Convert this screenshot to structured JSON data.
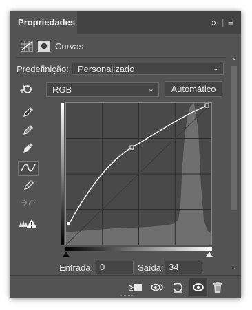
{
  "panel": {
    "tab_label": "Propriedades",
    "collapse_glyph": "»",
    "menu_glyph": "≡"
  },
  "header": {
    "title": "Curvas",
    "curves_icon": "curves-adjustment-icon",
    "mask_icon": "layer-mask-icon"
  },
  "preset": {
    "label": "Predefinição:",
    "value": "Personalizado"
  },
  "channel": {
    "value": "RGB",
    "auto_label": "Automático"
  },
  "tools": [
    "target-adjust-icon",
    "black-eyedropper-icon",
    "gray-eyedropper-icon",
    "white-eyedropper-icon",
    "curve-points-icon",
    "pencil-icon",
    "smooth-curve-icon",
    "clipping-warning-icon"
  ],
  "curve": {
    "points": [
      [
        0,
        34
      ],
      [
        95,
        181
      ],
      [
        255,
        255
      ]
    ],
    "histogram": "dense peak near highlights around level 230"
  },
  "io": {
    "input_label": "Entrada:",
    "input_value": "0",
    "output_label": "Saída:",
    "output_value": "34"
  },
  "footer": {
    "icons": [
      "clip-to-layer-icon",
      "view-previous-state-icon",
      "reset-icon",
      "visibility-icon",
      "trash-icon"
    ]
  }
}
